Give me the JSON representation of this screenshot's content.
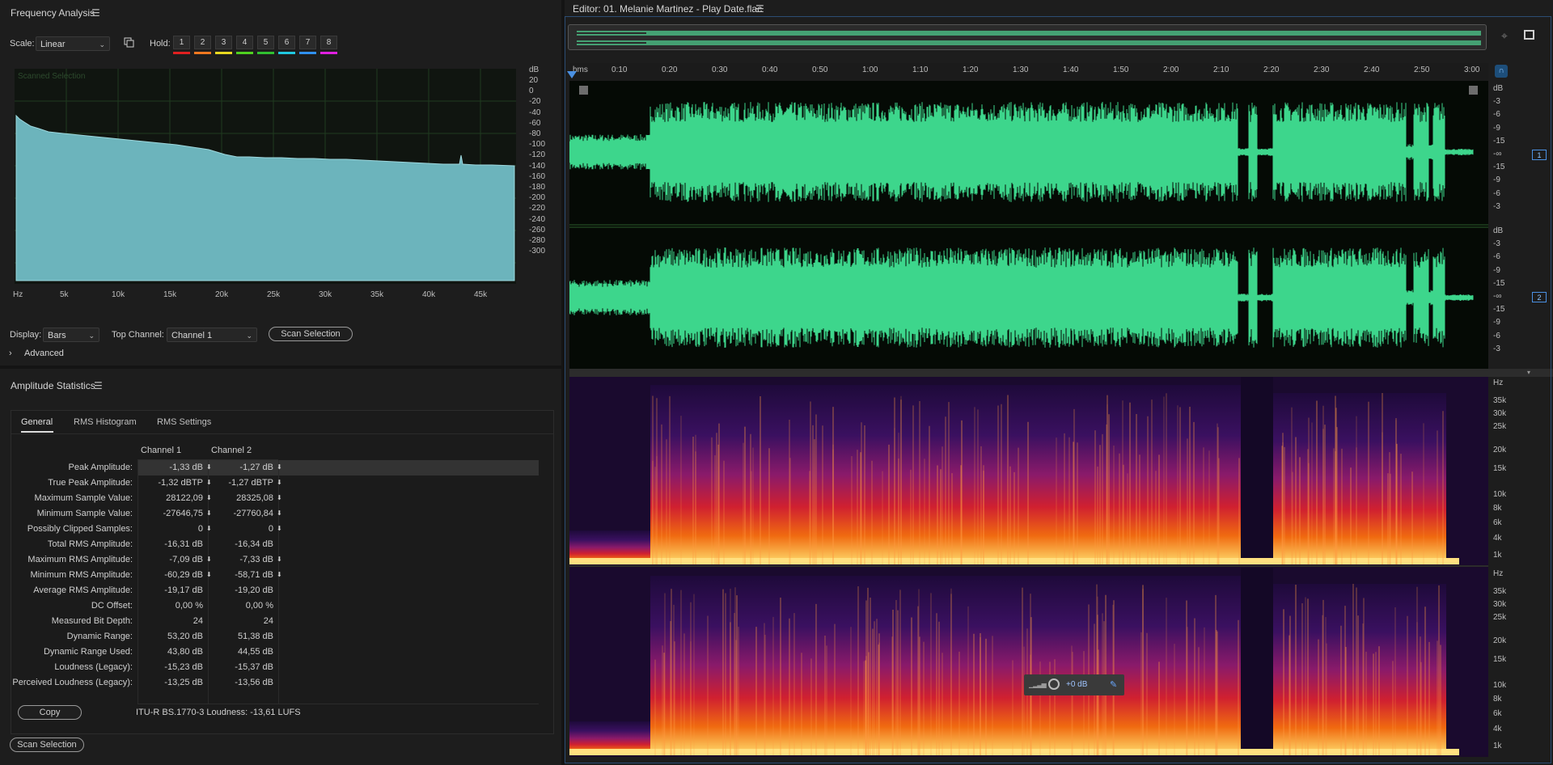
{
  "freq": {
    "title": "Frequency Analysis",
    "menu": "☰",
    "scale_label": "Scale:",
    "scale_value": "Linear",
    "hold_label": "Hold:",
    "hold_buttons": [
      "1",
      "2",
      "3",
      "4",
      "5",
      "6",
      "7",
      "8"
    ],
    "hold_colors": [
      "#e02020",
      "#f07820",
      "#e8d820",
      "#50d020",
      "#30c030",
      "#20c8e0",
      "#3090f0",
      "#e020e0"
    ],
    "overlay_text": "Scanned Selection",
    "db_unit": "dB",
    "db_ticks": [
      "20",
      "0",
      "-20",
      "-40",
      "-60",
      "-80",
      "-100",
      "-120",
      "-140",
      "-160",
      "-180",
      "-200",
      "-220",
      "-240",
      "-260",
      "-280",
      "-300"
    ],
    "hz_ticks": [
      "Hz",
      "5k",
      "10k",
      "15k",
      "20k",
      "25k",
      "30k",
      "35k",
      "40k",
      "45k"
    ],
    "display_label": "Display:",
    "display_value": "Bars",
    "top_channel_label": "Top Channel:",
    "top_channel_value": "Channel 1",
    "scan_button": "Scan Selection",
    "advanced_label": "Advanced",
    "fill_color": "#6cb4bc"
  },
  "amp": {
    "title": "Amplitude Statistics",
    "menu": "☰",
    "tabs": [
      "General",
      "RMS Histogram",
      "RMS Settings"
    ],
    "active_tab": "General",
    "col_headers": [
      "Channel 1",
      "Channel 2"
    ],
    "rows": [
      {
        "label": "Peak Amplitude:",
        "c1": "-1,33 dB",
        "c2": "-1,27 dB",
        "m1": true,
        "m2": true
      },
      {
        "label": "True Peak Amplitude:",
        "c1": "-1,32 dBTP",
        "c2": "-1,27 dBTP",
        "m1": true,
        "m2": true
      },
      {
        "label": "Maximum Sample Value:",
        "c1": "28122,09",
        "c2": "28325,08",
        "m1": true,
        "m2": true
      },
      {
        "label": "Minimum Sample Value:",
        "c1": "-27646,75",
        "c2": "-27760,84",
        "m1": true,
        "m2": true
      },
      {
        "label": "Possibly Clipped Samples:",
        "c1": "0",
        "c2": "0",
        "m1": true,
        "m2": true
      },
      {
        "label": "Total RMS Amplitude:",
        "c1": "-16,31 dB",
        "c2": "-16,34 dB",
        "m1": false,
        "m2": false
      },
      {
        "label": "Maximum RMS Amplitude:",
        "c1": "-7,09 dB",
        "c2": "-7,33 dB",
        "m1": true,
        "m2": true
      },
      {
        "label": "Minimum RMS Amplitude:",
        "c1": "-60,29 dB",
        "c2": "-58,71 dB",
        "m1": true,
        "m2": true
      },
      {
        "label": "Average RMS Amplitude:",
        "c1": "-19,17 dB",
        "c2": "-19,20 dB",
        "m1": false,
        "m2": false
      },
      {
        "label": "DC Offset:",
        "c1": "0,00 %",
        "c2": "0,00 %",
        "m1": false,
        "m2": false
      },
      {
        "label": "Measured Bit Depth:",
        "c1": "24",
        "c2": "24",
        "m1": false,
        "m2": false
      },
      {
        "label": "Dynamic Range:",
        "c1": "53,20 dB",
        "c2": "51,38 dB",
        "m1": false,
        "m2": false
      },
      {
        "label": "Dynamic Range Used:",
        "c1": "43,80 dB",
        "c2": "44,55 dB",
        "m1": false,
        "m2": false
      },
      {
        "label": "Loudness (Legacy):",
        "c1": "-15,23 dB",
        "c2": "-15,37 dB",
        "m1": false,
        "m2": false
      },
      {
        "label": "Perceived Loudness (Legacy):",
        "c1": "-13,25 dB",
        "c2": "-13,56 dB",
        "m1": false,
        "m2": false
      }
    ],
    "copy_button": "Copy",
    "loudness_text": "ITU-R BS.1770-3 Loudness: -13,61 LUFS",
    "scan_button": "Scan Selection"
  },
  "editor": {
    "title": "Editor: 01. Melanie Martinez - Play Date.flac",
    "menu": "☰",
    "time_ticks": [
      "hms",
      "0:10",
      "0:20",
      "0:30",
      "0:40",
      "0:50",
      "1:00",
      "1:10",
      "1:20",
      "1:30",
      "1:40",
      "1:50",
      "2:00",
      "2:10",
      "2:20",
      "2:30",
      "2:40",
      "2:50",
      "3:00"
    ],
    "db_scale_ch": [
      "dB",
      "-3",
      "-6",
      "-9",
      "-15",
      "-∞",
      "-15",
      "-9",
      "-6",
      "-3"
    ],
    "channel_badges": [
      "1",
      "2"
    ],
    "hz_scale": [
      "Hz",
      "35k",
      "30k",
      "25k",
      "20k",
      "15k",
      "10k",
      "8k",
      "6k",
      "4k",
      "1k"
    ],
    "wave_color": "#3dd68c",
    "hud_text": "+0 dB"
  }
}
